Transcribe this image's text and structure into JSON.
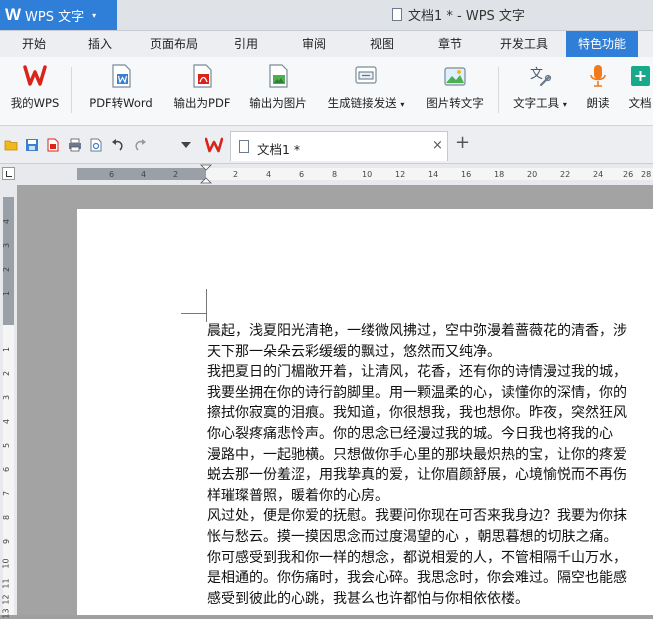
{
  "app": {
    "logo_glyph": "W",
    "name": "WPS 文字",
    "menu_arrow": "▾"
  },
  "window": {
    "title": "文档1 * - WPS 文字"
  },
  "tabs": [
    "开始",
    "插入",
    "页面布局",
    "引用",
    "审阅",
    "视图",
    "章节",
    "开发工具",
    "特色功能"
  ],
  "active_tab": "特色功能",
  "ribbon": [
    {
      "label": "我的WPS",
      "icon": "wps-logo-icon"
    },
    {
      "label": "PDF转Word",
      "icon": "pdf-to-word-icon"
    },
    {
      "label": "输出为PDF",
      "icon": "export-pdf-icon"
    },
    {
      "label": "输出为图片",
      "icon": "export-image-icon"
    },
    {
      "label": "生成链接发送",
      "icon": "share-link-icon",
      "dropdown": "▾"
    },
    {
      "label": "图片转文字",
      "icon": "image-to-text-icon"
    },
    {
      "label": "文字工具",
      "icon": "text-tools-icon",
      "dropdown": "▾"
    },
    {
      "label": "朗读",
      "icon": "microphone-icon"
    },
    {
      "label": "文档",
      "icon": "document-tool-icon"
    }
  ],
  "doc_tab": {
    "label": "文档1 *",
    "close": "×",
    "new": "+"
  },
  "ruler": {
    "h_numbers": [
      "6",
      "4",
      "2",
      "2",
      "4",
      "6",
      "8",
      "10",
      "12",
      "14",
      "16",
      "18",
      "20",
      "22",
      "24",
      "26",
      "28"
    ],
    "v_numbers": [
      "4",
      "3",
      "2",
      "1",
      "1",
      "2",
      "3",
      "4",
      "5",
      "6",
      "7",
      "8",
      "9",
      "10",
      "11",
      "12",
      "13"
    ]
  },
  "colors": {
    "accent": "#2f7ed8",
    "wps_red": "#d9241b"
  },
  "document": {
    "lines": [
      "晨起，浅夏阳光清艳，一缕微风拂过，空中弥漫着蔷薇花的清香，涉",
      "天下那一朵朵云彩缓缓的飘过，悠然而又纯净。",
      "我把夏日的门楣敞开着，让清风，花香，还有你的诗情漫过我的城，",
      "我要坐拥在你的诗行韵脚里。用一颗温柔的心，读懂你的深情，你的",
      "擦拭你寂寞的泪痕。我知道，你很想我，我也想你。昨夜，突然狂风",
      "你心裂疼痛悲怜声。你的思念已经漫过我的城。今日我也将我的心",
      "漫路中，一起驰横。只想做你手心里的那块最炽热的宝，让你的疼爱",
      "蜕去那一份羞涩，用我挚真的爱，让你眉颜舒展，心境愉悦而不再伤",
      "样璀璨普照，暖着你的心房。",
      "风过处，便是你爱的抚慰。我要问你现在可否来我身边？我要为你抹",
      "怅与愁云。摸一摸因思念而过度渴望的心 ，朝思暮想的切肤之痛。",
      "你可感受到我和你一样的想念，都说相爱的人，不管相隔千山万水，",
      "是相通的。你伤痛时，我会心碎。我思念时，你会难过。隔空也能感",
      "感受到彼此的心跳，我甚么也许都怕与你相依依楼。"
    ]
  }
}
